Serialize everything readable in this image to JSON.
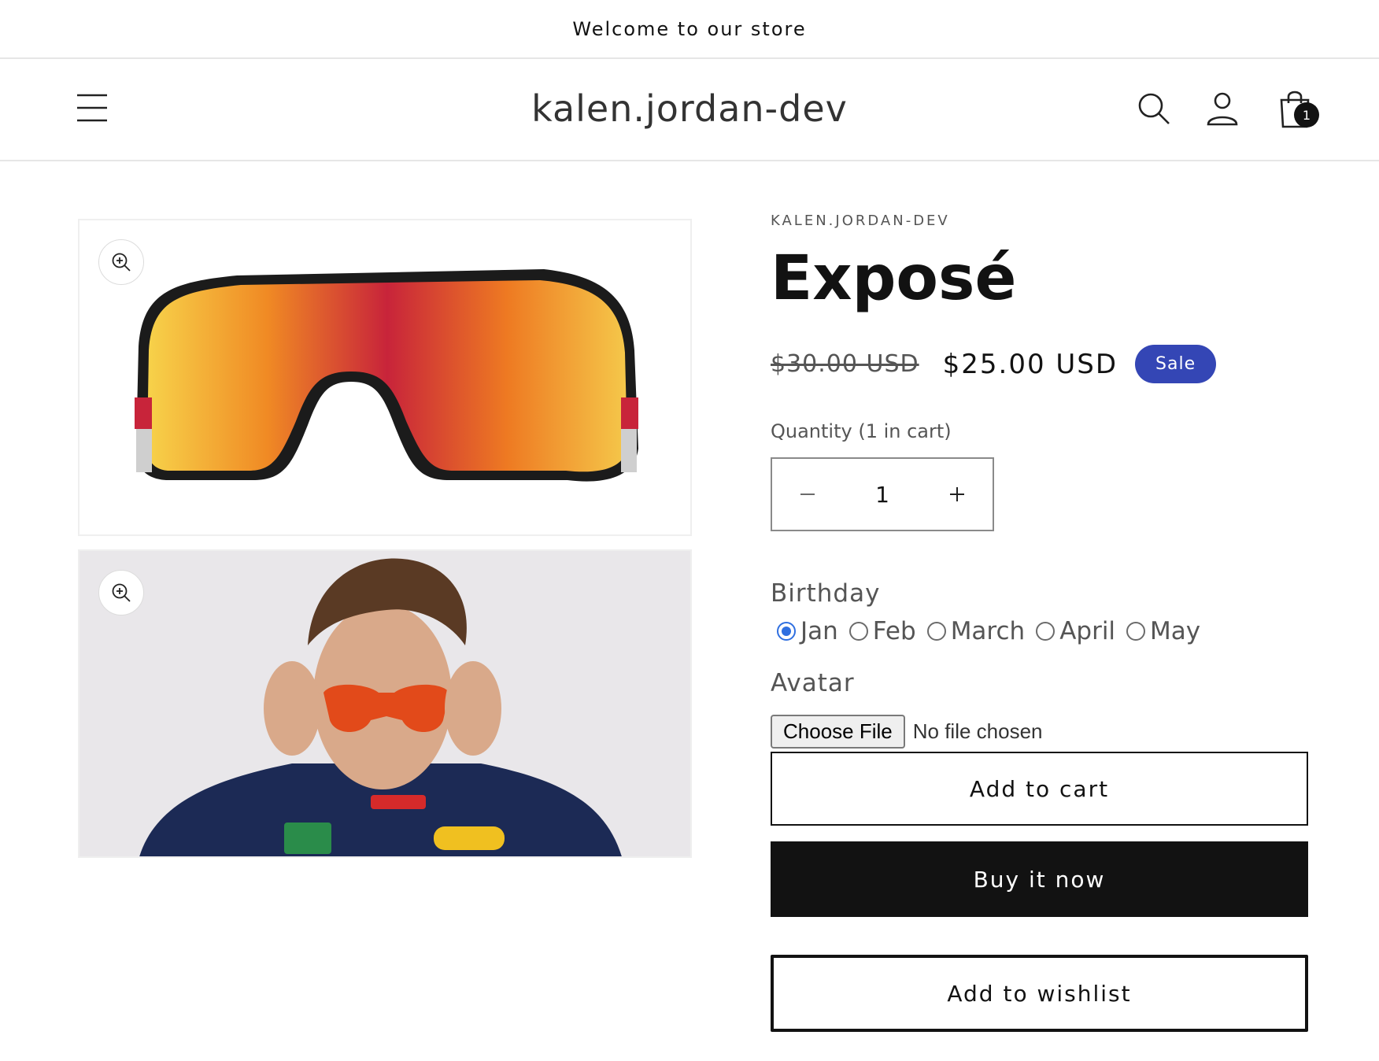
{
  "announcement": {
    "text": "Welcome to our store"
  },
  "header": {
    "logo": "kalen.jordan-dev",
    "cart_count": "1"
  },
  "product": {
    "vendor": "KALEN.JORDAN-DEV",
    "title": "Exposé",
    "price_regular": "$30.00 USD",
    "price_sale": "$25.00 USD",
    "sale_badge": "Sale",
    "quantity_label": "Quantity (1 in cart)",
    "quantity_value": "1",
    "birthday_label": "Birthday",
    "birthday_options": [
      "Jan",
      "Feb",
      "March",
      "April",
      "May"
    ],
    "birthday_selected": "Jan",
    "avatar_label": "Avatar",
    "file_button": "Choose File",
    "file_status": "No file chosen",
    "add_to_cart": "Add to cart",
    "buy_now": "Buy it now",
    "add_to_wishlist": "Add to wishlist"
  },
  "colors": {
    "sale_badge": "#3446b5",
    "buy_button": "#121212",
    "radio_selected": "#2f6fe0"
  },
  "icons": {
    "menu": "hamburger-menu-icon",
    "search": "search-icon",
    "account": "account-icon",
    "cart": "shopping-bag-icon",
    "zoom": "zoom-in-icon"
  }
}
